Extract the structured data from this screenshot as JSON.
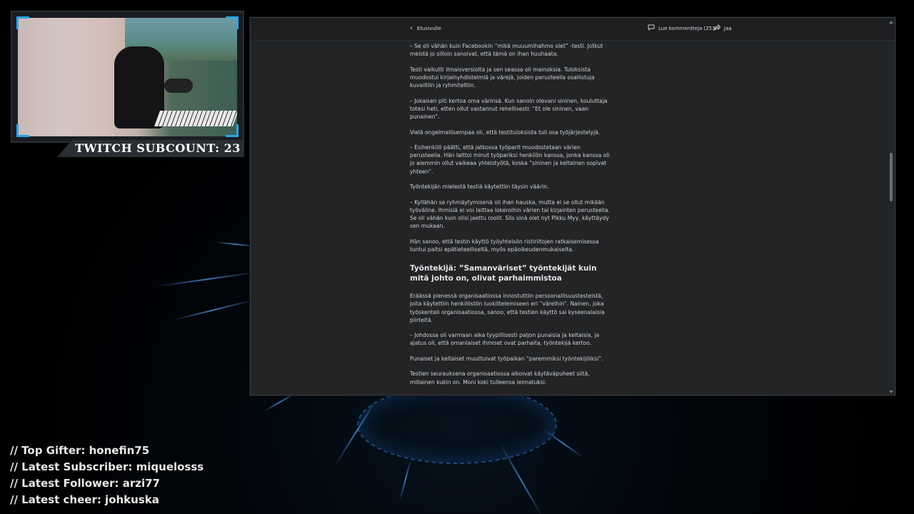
{
  "overlay": {
    "subcount": "TWITCH SUBCOUNT: 23",
    "stats": [
      "// Top Gifter: honefin75",
      "// Latest Subscriber: miquelosss",
      "// Latest Follower: arzi77",
      "// Latest cheer: johkuska"
    ]
  },
  "browser": {
    "back_label": "Etusivulle",
    "comments_label": "Lue kommentteja (253)",
    "share_label": "Jaa",
    "icons": {
      "back": "chevron-left-icon",
      "comments": "comment-icon",
      "share": "share-icon"
    }
  },
  "article": {
    "paragraphs_before_heading": [
      "– Se oli vähän kuin Facebookin ”mikä muuumihahmo olet” -testi. Jotkut meistä jo silloin sanoivat, että tämä on ihan huuhaata.",
      "Testi vaikutti ilmaisversiolta ja sen seassa oli mainoksia. Tuloksista muodostui kirjainyhdistelmiä ja värejä, joiden perusteella osallistuja kuvailtiin ja ryhmiteltiin.",
      "– Jokaisen piti kertoa oma värinsä. Kun sanoin olevani sininen, kouluttaja totesi heti, etten ollut vastannut rehellisesti: ”Et ole sininen, vaan punainen”.",
      "Vielä ongelmallisempaa oli, että testituloksista tuli osa työjärjestelyjä.",
      "– Esihenkilö päätti, että jatkossa työparit muodostetaan värien perusteella. Hän laittoi minut työpariksi henkilön kanssa, jonka kanssa oli jo aiemmin ollut vaikeaa yhteistyötä, koska ”sininen ja keltainen sopivat yhteen”.",
      "Työntekijän mielestä testiä käytettiin täysin väärin.",
      "– Kyllähän se ryhmäytymisenä oli ihan hauska, mutta ei se ollut mikään työväline. Ihmisiä ei voi laittaa lokeroihin värien tai kirjainten perusteella. Se oli vähän kuin olisi jaettu roolit. Siis sinä olet nyt Pikku Myy, käyttäydy sen mukaan.",
      "Hän sanoo, että testin käyttö työyhteisön ristiriitojen ratkaisemisessa tuntui paitsi epätieteelliseltä, myös epäoikeudenmukaiselta."
    ],
    "heading": "Työntekijä: ”Samanväriset” työntekijät kuin mitä johto on, olivat parhaimmistoa",
    "paragraphs_after_heading": [
      "Eräässä pienessä organisaatiossa innostuttiin persoonallisuustesteistä, joita käytettiin henkilöstön luokittelemiseen eri ”väreihin”. Nainen, joka työskenteli organisaatiossa, sanoo, että testien käyttö sai kyseenalaisia piirteitä.",
      "– Johdossa oli varmaan aika tyypillisesti paljon punaisia ja keltaisia, ja ajatus oli, että omanlaiset ihmiset ovat parhaita, työntekijä kertoo.",
      "Punaiset ja keltaiset muuttuivat työpaikan ”paremmiksi työntekijöiksi”.",
      "Testien seurauksena organisaatiossa alkoivat käytäväpuheet siitä, millainen kukin on. Moni koki tulleensa leimatuksi."
    ]
  },
  "colors": {
    "accent": "#2aa6e8",
    "page_bg": "#222426"
  }
}
